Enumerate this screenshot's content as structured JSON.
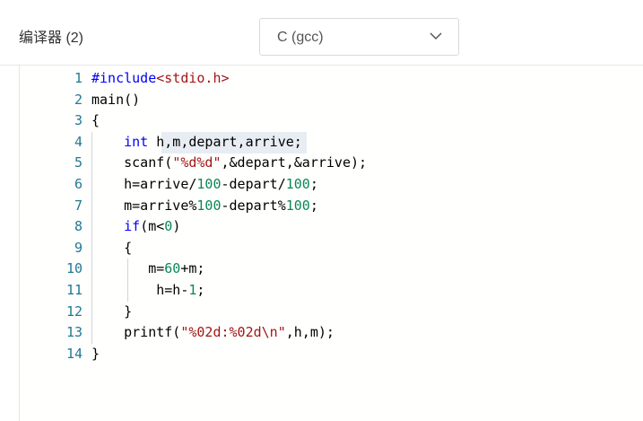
{
  "header": {
    "compiler_label": "编译器 (2)",
    "language_select": {
      "selected": "C (gcc)",
      "icon": "chevron-down-icon"
    }
  },
  "editor": {
    "line_numbers": [
      "1",
      "2",
      "3",
      "4",
      "5",
      "6",
      "7",
      "8",
      "9",
      "10",
      "11",
      "12",
      "13",
      "14"
    ],
    "lines": [
      "#include<stdio.h>",
      "main()",
      "{",
      "    int h,m,depart,arrive;",
      "    scanf(\"%d%d\",&depart,&arrive);",
      "    h=arrive/100-depart/100;",
      "    m=arrive%100-depart%100;",
      "    if(m<0)",
      "    {",
      "       m=60+m;",
      "        h=h-1;",
      "    }",
      "    printf(\"%02d:%02d\\n\",h,m);",
      "}"
    ]
  },
  "colors": {
    "keyword": "#0000ff",
    "string": "#a31515",
    "number": "#098658",
    "line_number": "#237893"
  }
}
